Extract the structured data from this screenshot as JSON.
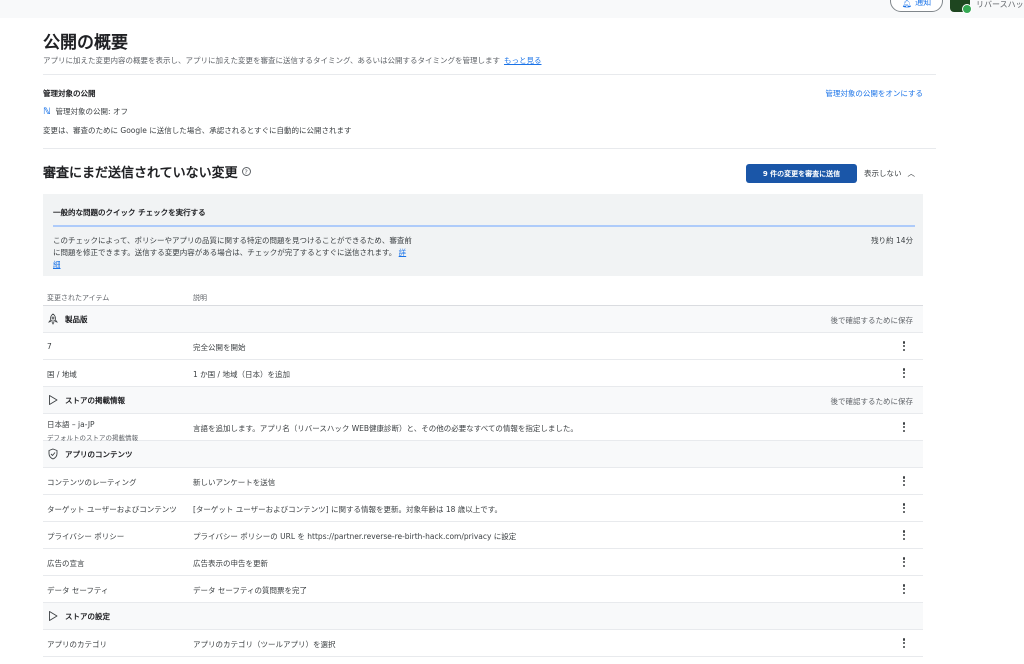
{
  "topbar": {
    "notify_label": "通知",
    "app_name": "リバースハッ"
  },
  "header": {
    "title": "公開の概要",
    "description": "アプリに加えた変更内容の概要を表示し、アプリに加えた変更を審査に送信するタイミング、あるいは公開するタイミングを管理します",
    "learn_more": "もっと見る"
  },
  "managed": {
    "title": "管理対象の公開",
    "status": "管理対象の公開: オフ",
    "description": "変更は、審査のために Google に送信した場合、承認されるとすぐに自動的に公開されます",
    "toggle_link": "管理対象の公開をオンにする"
  },
  "review": {
    "title": "審査にまだ送信されていない変更",
    "submit_label": "9 件の変更を審査に送信",
    "hide_label": "表示しない"
  },
  "quick_check": {
    "title": "一般的な問題のクイック チェックを実行する",
    "description": "このチェックによって、ポリシーやアプリの品質に関する特定の問題を見つけることができるため、審査前に問題を修正できます。送信する変更内容がある場合は、チェックが完了するとすぐに送信されます。",
    "details_link": "詳細",
    "remaining": "残り約 14分"
  },
  "table": {
    "col_item": "変更されたアイテム",
    "col_desc": "説明",
    "groups": [
      {
        "name": "製品版",
        "icon": "rocket-icon",
        "save_note": "後で確認するために保存",
        "rows": [
          {
            "item": "7",
            "sub": "",
            "desc": "完全公開を開始"
          },
          {
            "item": "国 / 地域",
            "sub": "",
            "desc": "1 か国 / 地域（日本）を追加"
          }
        ]
      },
      {
        "name": "ストアの掲載情報",
        "icon": "play-icon",
        "save_note": "後で確認するために保存",
        "rows": [
          {
            "item": "日本語 – ja-JP",
            "sub": "デフォルトのストアの掲載情報",
            "desc": "言語を追加します。アプリ名（リバースハック WEB健康診断）と、その他の必要なすべての情報を指定しました。"
          }
        ]
      },
      {
        "name": "アプリのコンテンツ",
        "icon": "shield-icon",
        "save_note": "",
        "rows": [
          {
            "item": "コンテンツのレーティング",
            "sub": "",
            "desc": "新しいアンケートを送信"
          },
          {
            "item": "ターゲット ユーザーおよびコンテンツ",
            "sub": "",
            "desc": "[ターゲット ユーザーおよびコンテンツ] に関する情報を更新。対象年齢は 18 歳以上です。"
          },
          {
            "item": "プライバシー ポリシー",
            "sub": "",
            "desc": "プライバシー ポリシーの URL を https://partner.reverse-re-birth-hack.com/privacy に設定"
          },
          {
            "item": "広告の宣言",
            "sub": "",
            "desc": "広告表示の申告を更新"
          },
          {
            "item": "データ セーフティ",
            "sub": "",
            "desc": "データ セーフティの質問票を完了"
          }
        ]
      },
      {
        "name": "ストアの設定",
        "icon": "play-icon",
        "save_note": "",
        "rows": [
          {
            "item": "アプリのカテゴリ",
            "sub": "",
            "desc": "アプリのカテゴリ（ツールアプリ）を選択"
          }
        ]
      }
    ]
  }
}
